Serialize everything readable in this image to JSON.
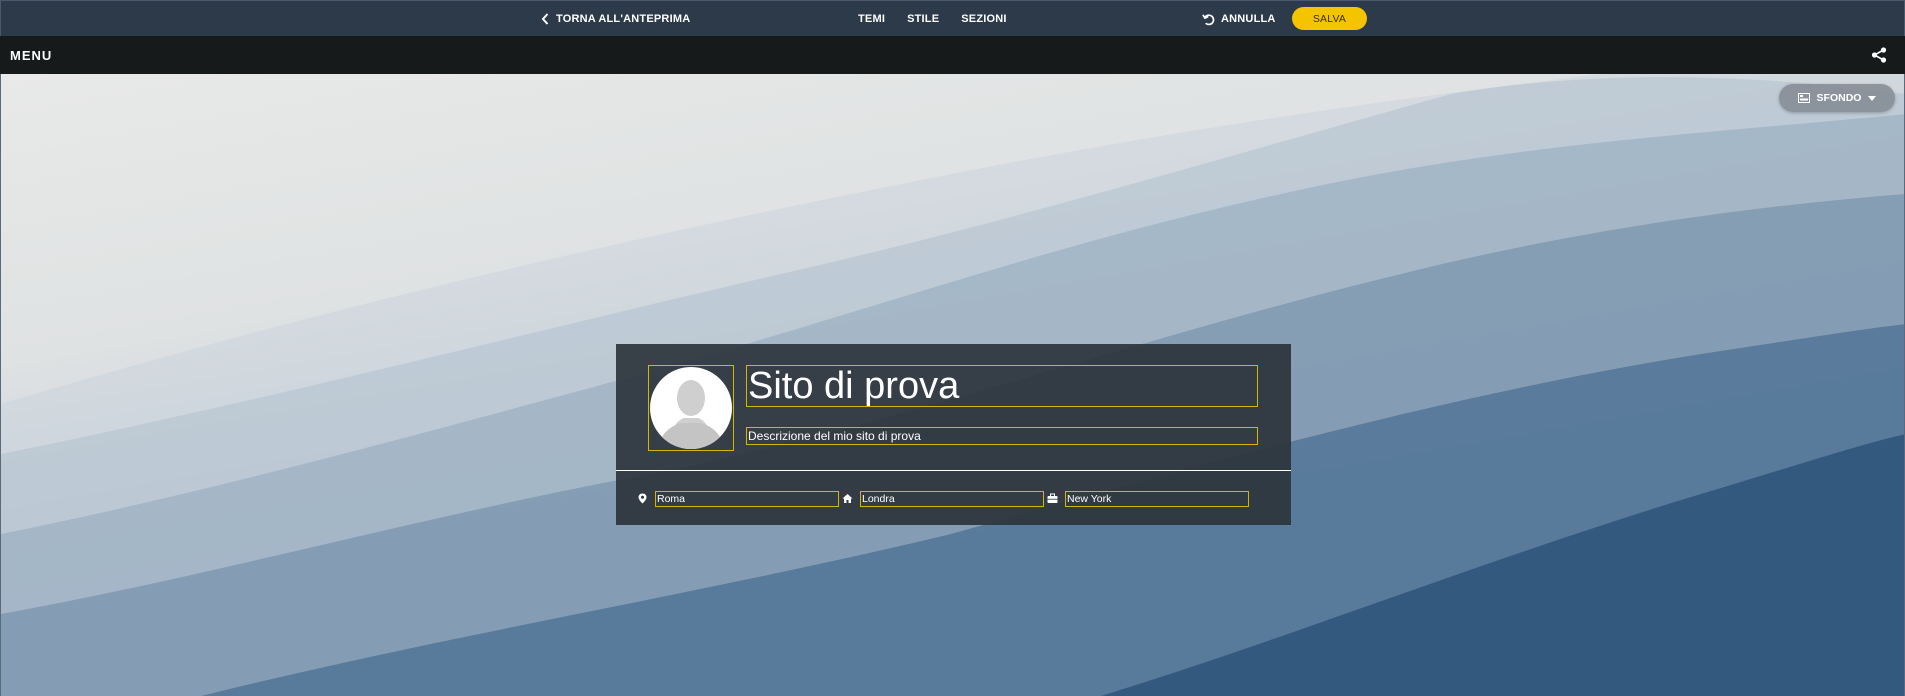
{
  "editor_bar": {
    "back_label": "TORNA ALL'ANTEPRIMA",
    "nav": [
      "TEMI",
      "STILE",
      "SEZIONI"
    ],
    "undo_label": "ANNULLA",
    "save_label": "SALVA"
  },
  "site_nav": {
    "menu_label": "MENU"
  },
  "hero": {
    "background_button_label": "SFONDO"
  },
  "profile": {
    "title": "Sito di prova",
    "description": "Descrizione del mio sito di prova",
    "locations": [
      {
        "icon": "map-pin-icon",
        "value": "Roma"
      },
      {
        "icon": "home-icon",
        "value": "Londra"
      },
      {
        "icon": "briefcase-icon",
        "value": "New York"
      }
    ]
  },
  "colors": {
    "editor_bar": "#2c3a4a",
    "site_nav": "#161a1b",
    "save_button": "#f5c400",
    "edit_outline": "#d6b600",
    "card": "#2c343c"
  }
}
